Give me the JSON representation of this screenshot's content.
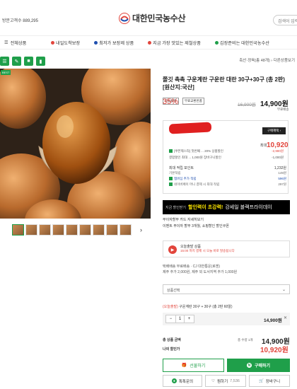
{
  "header": {
    "stat_text": "방문고객수 889,295",
    "logo_text": "대한민국농수산",
    "search_placeholder": "검색어 입력"
  },
  "nav": {
    "menu_label": "전체상품",
    "items": [
      {
        "label": "내일도착보장",
        "dot": "#e2453c"
      },
      {
        "label": "최저가 보장제 상품",
        "dot": "#1f4faf"
      },
      {
        "label": "지금 가장 맛있는 제철상품",
        "dot": "#e2453c"
      },
      {
        "label": "김장준비는 대한민국농수산",
        "dot": "#1f9f4a"
      }
    ]
  },
  "quick": [
    "☰",
    "✎",
    "■",
    "▮"
  ],
  "breadcrumb": "축산·정육(총 48개)  ›  다른상품보기",
  "product": {
    "photo_tag": "BEST",
    "title": "쫄깃 촉촉 구운계란 구운란 대란 30구+30구 (총 2판) [원산지:국산]",
    "badges": [
      "오늘출발",
      "무료교환반품"
    ],
    "discount": "35%",
    "original_price": "16,900원",
    "price": "14,900원",
    "shipping": "무료배송"
  },
  "coupon": {
    "button": "구매혜택 ›",
    "price": "10,920",
    "won": "최대",
    "rows": [
      {
        "label": "[쿠폰제스타] 첫번째 ... 20% 상품할인",
        "value": "-2,980원"
      },
      {
        "label": "결합할인 최대 ... 1,000원 장바구니할인",
        "value": "-1,000원"
      }
    ],
    "points_title": "최대 적립 포인트",
    "points_value": "1,232원",
    "points_rows": [
      {
        "label": "기본적립",
        "value": "149원"
      },
      {
        "label": "멤버십 추가 적립",
        "value": "596원"
      },
      {
        "label": "네이버페이 머니 결제 시 최대 적립",
        "value": "297원"
      }
    ]
  },
  "banner": {
    "pre": "지금 할인받기",
    "highlight": "할인력이 초강력!",
    "post": "강세일 블랙프라이데이"
  },
  "gifts": [
    "무이자할부  카드 자세히보기",
    "이벤트  무이자 할부 3개월, 쇼핑할인 할인쿠폰"
  ],
  "today": {
    "line1": "오늘출발 상품",
    "line2": "15:00 까지 결제 시 오늘 바로 발송됩니다"
  },
  "delivery": [
    "택배배송  무료배송 · CJ 대한통운(로젠)",
    "제주 추가 2,000원, 제주 외 도서지역 추가 1,000원"
  ],
  "option": {
    "placeholder": "상품선택",
    "selected_prefix": "(오늘출발)",
    "selected_text": "구운계란 30구 + 30구 (총 2판 60알)",
    "qty": "1",
    "line_price": "14,900원"
  },
  "totals": {
    "total_label": "총 상품 금액",
    "qty_text": "총 수량 1개",
    "total_price": "14,900원",
    "my_label": "나의 할인가",
    "my_price": "10,920원"
  },
  "buttons": {
    "gift": "선물하기",
    "buy": "구매하기",
    "talk": "톡톡문의",
    "wish": "찜하기",
    "wish_count": "7,536",
    "cart": "장바구니"
  }
}
